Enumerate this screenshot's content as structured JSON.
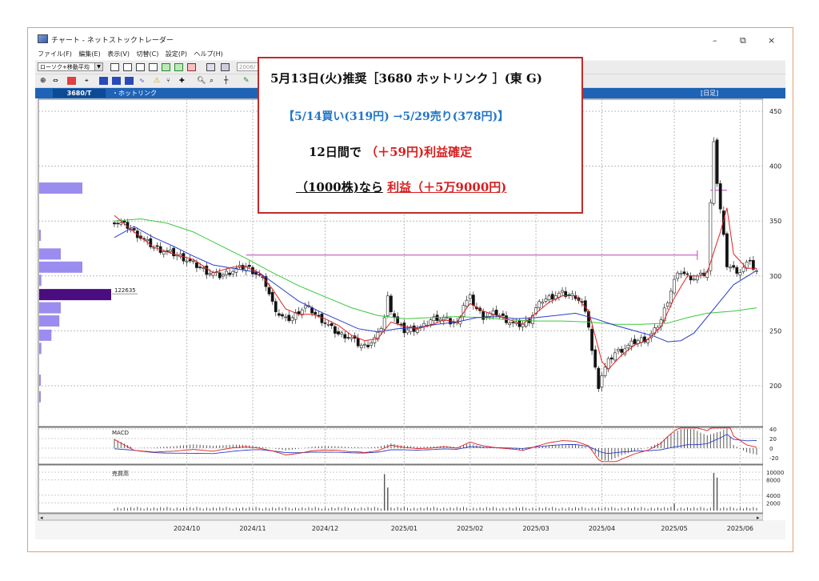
{
  "window": {
    "title": "チャート - ネットストックトレーダー",
    "menu": [
      "ファイル(F)",
      "編集(E)",
      "表示(V)",
      "切替(C)",
      "設定(P)",
      "ヘルプ(H)"
    ],
    "indicator_select": "ローソク+移動平均",
    "date_field": "2006/",
    "stock_code": "3680/T",
    "stock_name": "・ホットリンク",
    "period": "[日足]",
    "volume_profile_label": "122635",
    "macd_title": "MACD",
    "volume_title": "売買高"
  },
  "callout": {
    "line1": "5月13日(火)推奨［3680 ホットリンク ］(東 G)",
    "line2": "【5/14買い(319円) →5/29売り(378円)】",
    "line3_prefix": "12日間で",
    "line3_red": "（＋59円)利益確定",
    "line4_prefix": "（1000株)なら",
    "line4_red": "利益（＋5万9000円)"
  },
  "colors": {
    "candle_up": "#ffffff",
    "candle_down": "#111111",
    "ma_short": "#e02020",
    "ma_mid": "#2a3fc8",
    "ma_long": "#3cc83c",
    "hline": "#c040c0",
    "profile": "#9b8cf0",
    "profile_peak": "#4a0d80",
    "header": "#1e63b6",
    "accent_red": "#c22b2b"
  },
  "chart_data": [
    {
      "type": "candlestick",
      "yrange": [
        165,
        460
      ],
      "y_ticks": [
        200,
        250,
        300,
        350,
        400,
        450
      ],
      "x_ticks": [
        "2024/10",
        "2024/11",
        "2024/12",
        "2025/01",
        "2025/02",
        "2025/03",
        "2025/04",
        "2025/05",
        "2025/06"
      ],
      "close_path": [
        [
          0,
          350
        ],
        [
          4,
          345
        ],
        [
          8,
          335
        ],
        [
          12,
          326
        ],
        [
          16,
          322
        ],
        [
          20,
          318
        ],
        [
          24,
          311
        ],
        [
          28,
          304
        ],
        [
          32,
          300
        ],
        [
          36,
          305
        ],
        [
          40,
          309
        ],
        [
          44,
          300
        ],
        [
          46,
          292
        ],
        [
          48,
          275
        ],
        [
          50,
          265
        ],
        [
          52,
          260
        ],
        [
          54,
          262
        ],
        [
          56,
          268
        ],
        [
          58,
          272
        ],
        [
          60,
          268
        ],
        [
          62,
          262
        ],
        [
          64,
          258
        ],
        [
          66,
          252
        ],
        [
          68,
          247
        ],
        [
          70,
          246
        ],
        [
          72,
          243
        ],
        [
          74,
          238
        ],
        [
          76,
          236
        ],
        [
          78,
          240
        ],
        [
          80,
          246
        ],
        [
          82,
          262
        ],
        [
          83,
          280
        ],
        [
          84,
          270
        ],
        [
          86,
          256
        ],
        [
          88,
          250
        ],
        [
          90,
          252
        ],
        [
          92,
          252
        ],
        [
          94,
          254
        ],
        [
          96,
          260
        ],
        [
          98,
          262
        ],
        [
          100,
          261
        ],
        [
          102,
          258
        ],
        [
          104,
          256
        ],
        [
          106,
          274
        ],
        [
          108,
          280
        ],
        [
          110,
          270
        ],
        [
          112,
          263
        ],
        [
          114,
          265
        ],
        [
          116,
          266
        ],
        [
          118,
          262
        ],
        [
          120,
          258
        ],
        [
          122,
          255
        ],
        [
          124,
          256
        ],
        [
          126,
          260
        ],
        [
          128,
          270
        ],
        [
          130,
          278
        ],
        [
          132,
          280
        ],
        [
          134,
          283
        ],
        [
          136,
          284
        ],
        [
          138,
          282
        ],
        [
          140,
          282
        ],
        [
          142,
          275
        ],
        [
          144,
          255
        ],
        [
          145,
          232
        ],
        [
          146,
          215
        ],
        [
          147,
          200
        ],
        [
          148,
          210
        ],
        [
          150,
          222
        ],
        [
          152,
          230
        ],
        [
          154,
          233
        ],
        [
          156,
          236
        ],
        [
          158,
          240
        ],
        [
          160,
          242
        ],
        [
          162,
          243
        ],
        [
          164,
          250
        ],
        [
          166,
          260
        ],
        [
          168,
          278
        ],
        [
          170,
          296
        ],
        [
          172,
          304
        ],
        [
          174,
          300
        ],
        [
          176,
          298
        ],
        [
          178,
          300
        ],
        [
          180,
          304
        ],
        [
          181,
          365
        ],
        [
          182,
          425
        ],
        [
          183,
          385
        ],
        [
          184,
          360
        ],
        [
          186,
          310
        ],
        [
          188,
          306
        ],
        [
          190,
          304
        ],
        [
          192,
          310
        ],
        [
          193,
          316
        ],
        [
          194,
          306
        ],
        [
          195,
          303
        ]
      ],
      "ma_short": [
        [
          0,
          355
        ],
        [
          6,
          340
        ],
        [
          12,
          326
        ],
        [
          18,
          320
        ],
        [
          24,
          315
        ],
        [
          30,
          303
        ],
        [
          36,
          308
        ],
        [
          40,
          308
        ],
        [
          44,
          303
        ],
        [
          48,
          288
        ],
        [
          52,
          270
        ],
        [
          56,
          265
        ],
        [
          60,
          265
        ],
        [
          64,
          261
        ],
        [
          68,
          255
        ],
        [
          72,
          246
        ],
        [
          76,
          241
        ],
        [
          80,
          243
        ],
        [
          84,
          258
        ],
        [
          88,
          254
        ],
        [
          92,
          252
        ],
        [
          96,
          255
        ],
        [
          100,
          260
        ],
        [
          104,
          258
        ],
        [
          108,
          275
        ],
        [
          112,
          268
        ],
        [
          116,
          264
        ],
        [
          120,
          260
        ],
        [
          124,
          256
        ],
        [
          128,
          266
        ],
        [
          132,
          276
        ],
        [
          136,
          282
        ],
        [
          140,
          282
        ],
        [
          144,
          268
        ],
        [
          148,
          222
        ],
        [
          150,
          215
        ],
        [
          154,
          228
        ],
        [
          158,
          237
        ],
        [
          162,
          242
        ],
        [
          166,
          254
        ],
        [
          170,
          280
        ],
        [
          174,
          300
        ],
        [
          178,
          300
        ],
        [
          180,
          303
        ],
        [
          184,
          340
        ],
        [
          186,
          362
        ],
        [
          188,
          320
        ],
        [
          192,
          307
        ],
        [
          195,
          307
        ]
      ],
      "ma_mid": [
        [
          0,
          335
        ],
        [
          6,
          345
        ],
        [
          12,
          335
        ],
        [
          18,
          327
        ],
        [
          24,
          318
        ],
        [
          30,
          310
        ],
        [
          36,
          307
        ],
        [
          44,
          303
        ],
        [
          50,
          290
        ],
        [
          56,
          277
        ],
        [
          62,
          268
        ],
        [
          68,
          260
        ],
        [
          74,
          252
        ],
        [
          80,
          249
        ],
        [
          86,
          252
        ],
        [
          92,
          253
        ],
        [
          98,
          256
        ],
        [
          104,
          258
        ],
        [
          110,
          262
        ],
        [
          116,
          263
        ],
        [
          122,
          261
        ],
        [
          128,
          262
        ],
        [
          134,
          264
        ],
        [
          140,
          266
        ],
        [
          146,
          261
        ],
        [
          152,
          255
        ],
        [
          158,
          250
        ],
        [
          164,
          245
        ],
        [
          168,
          240
        ],
        [
          172,
          241
        ],
        [
          176,
          248
        ],
        [
          182,
          270
        ],
        [
          188,
          292
        ],
        [
          195,
          305
        ]
      ],
      "ma_long": [
        [
          0,
          350
        ],
        [
          8,
          352
        ],
        [
          16,
          348
        ],
        [
          24,
          340
        ],
        [
          32,
          328
        ],
        [
          40,
          316
        ],
        [
          48,
          303
        ],
        [
          56,
          291
        ],
        [
          64,
          281
        ],
        [
          72,
          271
        ],
        [
          80,
          264
        ],
        [
          88,
          261
        ],
        [
          96,
          262
        ],
        [
          104,
          263
        ],
        [
          112,
          262
        ],
        [
          120,
          260
        ],
        [
          128,
          259
        ],
        [
          136,
          259
        ],
        [
          144,
          258
        ],
        [
          152,
          256
        ],
        [
          160,
          256
        ],
        [
          168,
          257
        ],
        [
          174,
          262
        ],
        [
          180,
          266
        ],
        [
          188,
          268
        ],
        [
          195,
          271
        ]
      ],
      "annotations": [
        {
          "price": 319
        },
        {
          "price": 378
        }
      ],
      "volume_profile": [
        {
          "price": 380,
          "amount": 0.6
        },
        {
          "price": 337,
          "amount": 0.02
        },
        {
          "price": 320,
          "amount": 0.3
        },
        {
          "price": 308,
          "amount": 0.6
        },
        {
          "price": 296,
          "amount": 0.03
        },
        {
          "price": 283,
          "amount": 1.0
        },
        {
          "price": 271,
          "amount": 0.3
        },
        {
          "price": 259,
          "amount": 0.28
        },
        {
          "price": 246,
          "amount": 0.17
        },
        {
          "price": 234,
          "amount": 0.03
        },
        {
          "price": 205,
          "amount": 0.01
        },
        {
          "price": 190,
          "amount": 0.01
        }
      ]
    },
    {
      "type": "macd",
      "title": "MACD",
      "y_ticks": [
        40,
        20,
        0,
        -20
      ],
      "yrange": [
        -30,
        45
      ]
    },
    {
      "type": "bar",
      "title": "売買高",
      "y_ticks": [
        10000,
        8000,
        4000,
        2000
      ],
      "yrange": [
        0,
        12000
      ],
      "spikes": [
        {
          "i": 82,
          "v": 9500
        },
        {
          "i": 83,
          "v": 6000
        },
        {
          "i": 170,
          "v": 1800
        },
        {
          "i": 182,
          "v": 9800
        },
        {
          "i": 183,
          "v": 8600
        }
      ]
    }
  ]
}
